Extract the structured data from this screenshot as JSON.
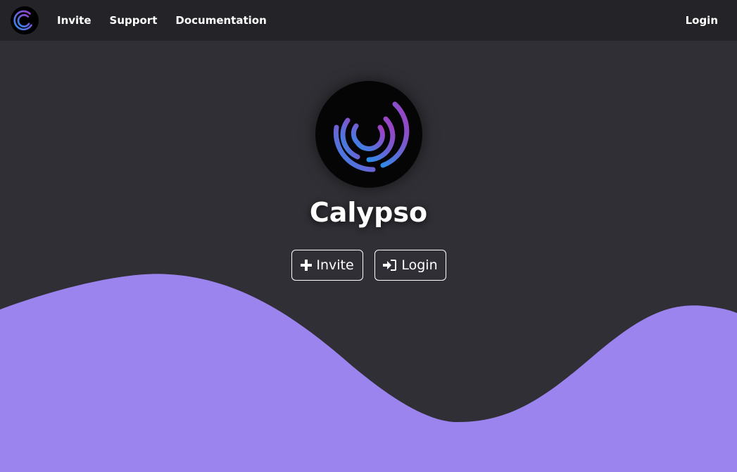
{
  "nav": {
    "logo_icon": "calypso-logo-icon",
    "links": [
      "Invite",
      "Support",
      "Documentation"
    ],
    "login": "Login"
  },
  "hero": {
    "logo_icon": "calypso-logo-icon",
    "title": "Calypso",
    "invite_button": {
      "label": "Invite",
      "icon": "plus-icon"
    },
    "login_button": {
      "label": "Login",
      "icon": "sign-in-icon"
    }
  },
  "colors": {
    "background": "#2f2f35",
    "navbar": "#242428",
    "wave": "#9b84ee",
    "gradient_start": "#2f8ae8",
    "gradient_end": "#9b3cc8"
  }
}
